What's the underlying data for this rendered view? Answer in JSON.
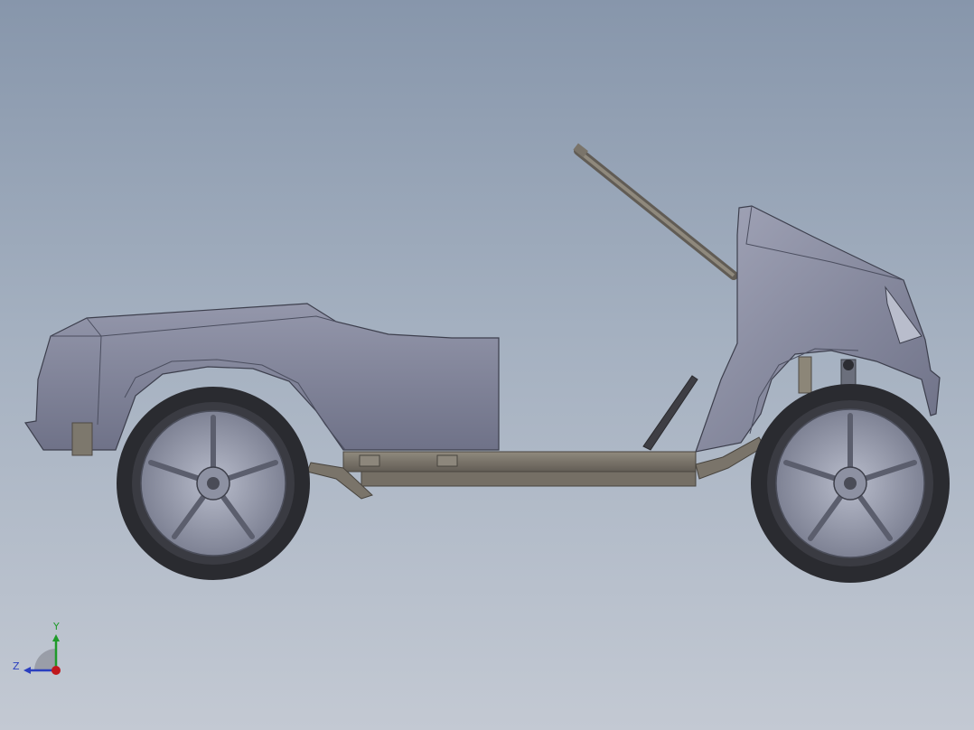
{
  "viewport": {
    "background_top": "#8796ab",
    "background_bottom": "#c3c9d3"
  },
  "model": {
    "body_color": "#7c7f95",
    "frame_color": "#726c62",
    "tire_color": "#2a2b30",
    "rim_color": "#9ea3b3"
  },
  "triad": {
    "y_label": "Y",
    "z_label": "Z",
    "y_color": "#1f9a2a",
    "z_color": "#2a3fbf",
    "x_color": "#c0181c"
  }
}
